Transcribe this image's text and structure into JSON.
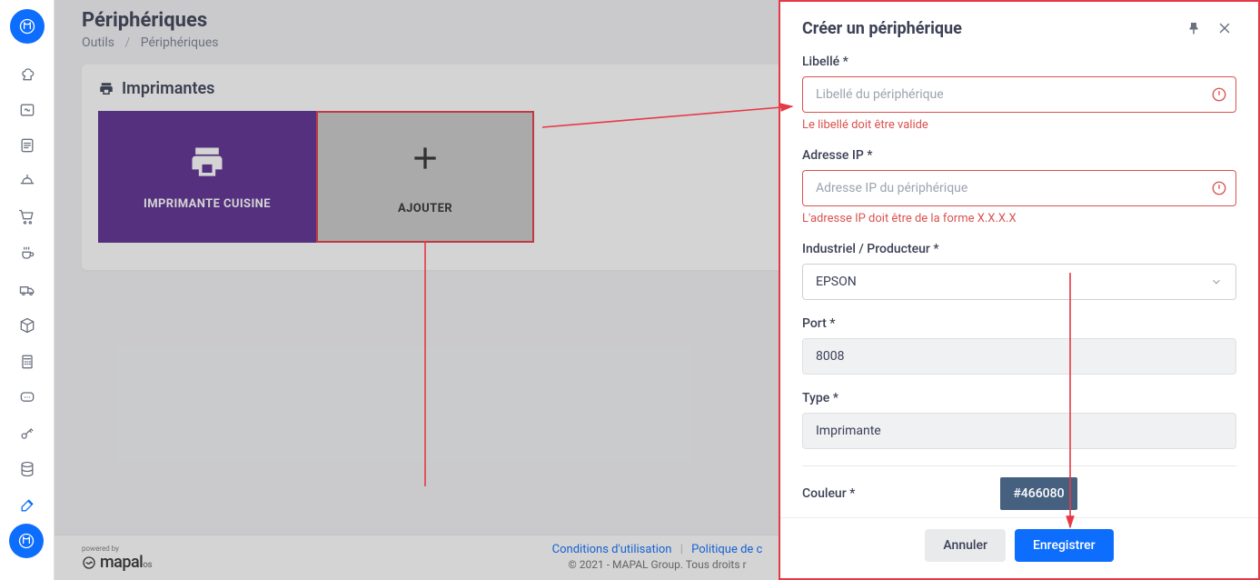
{
  "header": {
    "title": "Périphériques",
    "breadcrumb": {
      "root": "Outils",
      "current": "Périphériques"
    }
  },
  "panel": {
    "title": "Imprimantes",
    "cards": {
      "printer": "IMPRIMANTE CUISINE",
      "add": "AJOUTER"
    }
  },
  "footer": {
    "conditions": "Conditions d'utilisation",
    "privacy": "Politique de c",
    "copyright": "© 2021 - MAPAL Group. Tous droits r",
    "powered_top": "powered by",
    "powered_logo": "mapal",
    "powered_suffix": "os"
  },
  "drawer": {
    "title": "Créer un périphérique",
    "libelle": {
      "label": "Libellé *",
      "placeholder": "Libellé du périphérique",
      "error": "Le libellé doit être valide"
    },
    "ip": {
      "label": "Adresse IP *",
      "placeholder": "Adresse IP du périphérique",
      "error": "L'adresse IP doit être de la forme X.X.X.X"
    },
    "manufacturer": {
      "label": "Industriel / Producteur *",
      "value": "EPSON"
    },
    "port": {
      "label": "Port *",
      "value": "8008"
    },
    "type": {
      "label": "Type *",
      "value": "Imprimante"
    },
    "color": {
      "label": "Couleur *",
      "value": "#466080"
    },
    "buttons": {
      "cancel": "Annuler",
      "save": "Enregistrer"
    }
  }
}
